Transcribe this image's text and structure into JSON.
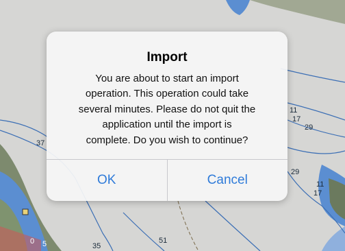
{
  "map": {
    "depth_soundings": [
      {
        "id": "d37",
        "text": "37"
      },
      {
        "id": "d11",
        "text": "11"
      },
      {
        "id": "d17a",
        "text": "17"
      },
      {
        "id": "d29a",
        "text": "29"
      },
      {
        "id": "d29b",
        "text": "29"
      },
      {
        "id": "d11b",
        "text": "11"
      },
      {
        "id": "d17b",
        "text": "17"
      },
      {
        "id": "d35",
        "text": "35"
      },
      {
        "id": "d51",
        "text": "51"
      },
      {
        "id": "d5",
        "text": "5"
      },
      {
        "id": "d0",
        "text": "0"
      }
    ]
  },
  "dialog": {
    "title": "Import",
    "message": "You are about to start an import\noperation.  This operation could take\nseveral minutes. Please do not quit the\napplication until the import is\ncomplete. Do you wish to continue?",
    "ok_label": "OK",
    "cancel_label": "Cancel"
  },
  "colors": {
    "button_text": "#2f7bd9",
    "dialog_bg": "#f6f6f6",
    "map_land": "#d8d8d6",
    "map_water_shallow": "#5e8fd6"
  }
}
